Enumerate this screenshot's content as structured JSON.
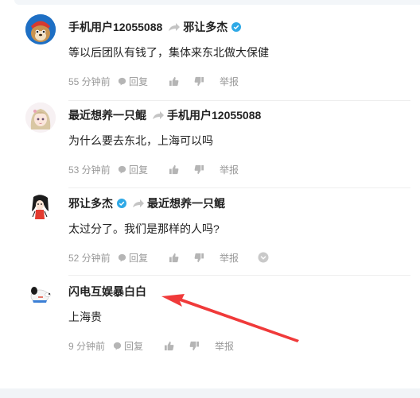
{
  "comments": [
    {
      "user": "手机用户12055088",
      "reply_to": "邪让多杰",
      "text": "等以后团队有钱了，集体来东北做大保健",
      "time": "55 分钟前",
      "reply_label": "回复",
      "report_label": "举报"
    },
    {
      "user": "最近想养一只鲲",
      "reply_to": "手机用户12055088",
      "text": "为什么要去东北，上海可以吗",
      "time": "53 分钟前",
      "reply_label": "回复",
      "report_label": "举报"
    },
    {
      "user": "邪让多杰",
      "reply_to": "最近想养一只鲲",
      "text": "太过分了。我们是那样的人吗?",
      "time": "52 分钟前",
      "reply_label": "回复",
      "report_label": "举报"
    },
    {
      "user": "闪电互娱暴白白",
      "text": "上海贵",
      "time": "9 分钟前",
      "reply_label": "回复",
      "report_label": "举报"
    }
  ],
  "colors": {
    "verified": "#2fa9e6",
    "annotation_arrow": "#f03a3a",
    "meta_text": "#999999"
  },
  "icons": [
    "verified-icon",
    "reply-arrow-icon",
    "comment-bubble-icon",
    "thumbs-up-icon",
    "thumbs-down-icon",
    "chevron-down-icon"
  ]
}
